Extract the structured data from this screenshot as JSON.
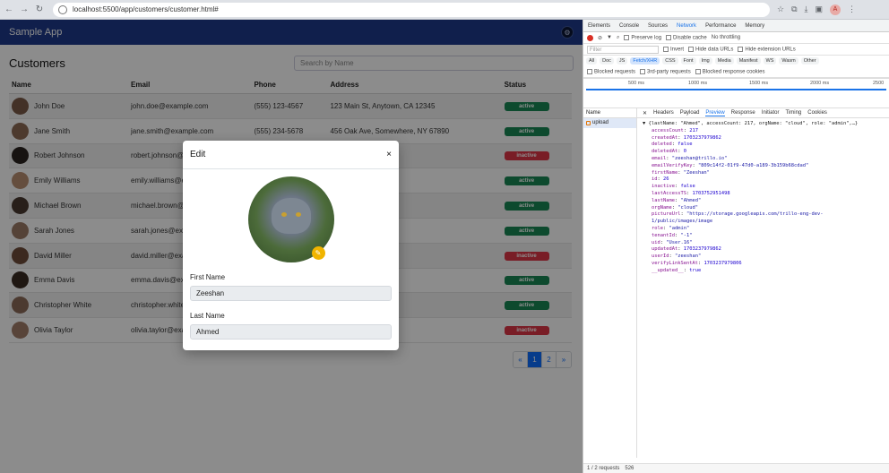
{
  "browser": {
    "url": "localhost:5500/app/customers/customer.html#",
    "profile_initial": "A"
  },
  "app": {
    "brand": "Sample App",
    "page_title": "Customers",
    "search_placeholder": "Search by Name",
    "columns": [
      "Name",
      "Email",
      "Phone",
      "Address",
      "Status"
    ],
    "rows": [
      {
        "name": "John Doe",
        "email": "john.doe@example.com",
        "phone": "(555) 123-4567",
        "address": "123 Main St, Anytown, CA 12345",
        "status": "active"
      },
      {
        "name": "Jane Smith",
        "email": "jane.smith@example.com",
        "phone": "(555) 234-5678",
        "address": "456 Oak Ave, Somewhere, NY 67890",
        "status": "active"
      },
      {
        "name": "Robert Johnson",
        "email": "robert.johnson@e",
        "phone": "",
        "address": "where, TX 45678",
        "status": "inactive"
      },
      {
        "name": "Emily Williams",
        "email": "emily.williams@ex",
        "phone": "",
        "address": "ytown, FL 98765",
        "status": "active"
      },
      {
        "name": "Michael Brown",
        "email": "michael.brown@e",
        "phone": "",
        "address": "where, CA 54321",
        "status": "active"
      },
      {
        "name": "Sarah Jones",
        "email": "sarah.jones@exa",
        "phone": "",
        "address": "ytown, TX 98765",
        "status": "active"
      },
      {
        "name": "David Miller",
        "email": "david.miller@exa",
        "phone": "",
        "address": "newhere, NY 23456",
        "status": "inactive"
      },
      {
        "name": "Emma Davis",
        "email": "emma.davis@exa",
        "phone": "",
        "address": "ewhere, CA 87654",
        "status": "active"
      },
      {
        "name": "Christopher White",
        "email": "christopher.white@",
        "phone": "",
        "address": "ytown, TX 76543",
        "status": "active"
      },
      {
        "name": "Olivia Taylor",
        "email": "olivia.taylor@exa",
        "phone": "",
        "address": "newhere, FL 65432",
        "status": "inactive"
      }
    ],
    "pagination": {
      "prev": "«",
      "pages": [
        "1",
        "2"
      ],
      "next": "»",
      "current": "1"
    }
  },
  "modal": {
    "title": "Edit",
    "close": "×",
    "first_name_label": "First Name",
    "first_name_value": "Zeeshan",
    "last_name_label": "Last Name",
    "last_name_value": "Ahmed"
  },
  "devtools": {
    "tabs": [
      "Elements",
      "Console",
      "Sources",
      "Network",
      "Performance",
      "Memory"
    ],
    "active_tab": "Network",
    "preserve_log": "Preserve log",
    "disable_cache": "Disable cache",
    "throttling": "No throttling",
    "filter_placeholder": "Filter",
    "invert": "Invert",
    "hide_data_urls": "Hide data URLs",
    "hide_ext_urls": "Hide extension URLs",
    "types": [
      "All",
      "Doc",
      "JS",
      "Fetch/XHR",
      "CSS",
      "Font",
      "Img",
      "Media",
      "Manifest",
      "WS",
      "Wasm",
      "Other"
    ],
    "active_type": "Fetch/XHR",
    "blocked_cookies": "Blocked response cookies",
    "blocked_requests": "Blocked requests",
    "third_party": "3rd-party requests",
    "timeline_ticks": [
      "500 ms",
      "1000 ms",
      "1500 ms",
      "2000 ms",
      "2500"
    ],
    "list_header": "Name",
    "request_name": "upload",
    "panel_tabs": [
      "Headers",
      "Payload",
      "Preview",
      "Response",
      "Initiator",
      "Timing",
      "Cookies"
    ],
    "active_panel_tab": "Preview",
    "summary": "{lastName: \"Ahmed\", accessCount: 217, orgName: \"cloud\", role: \"admin\",…}",
    "fields": [
      {
        "k": "accessCount",
        "v": "217",
        "t": "n"
      },
      {
        "k": "createdAt",
        "v": "1703237979862",
        "t": "n"
      },
      {
        "k": "deleted",
        "v": "false",
        "t": "n"
      },
      {
        "k": "deletedAt",
        "v": "0",
        "t": "n"
      },
      {
        "k": "email",
        "v": "\"zeeshan@trillo.io\"",
        "t": "s"
      },
      {
        "k": "emailVerifyKey",
        "v": "\"809c14f2-01f9-47d0-a189-3b159b68cdad\"",
        "t": "s"
      },
      {
        "k": "firstName",
        "v": "\"Zeeshan\"",
        "t": "s"
      },
      {
        "k": "id",
        "v": "26",
        "t": "n"
      },
      {
        "k": "inactive",
        "v": "false",
        "t": "n"
      },
      {
        "k": "lastAccessTS",
        "v": "1703752951498",
        "t": "n"
      },
      {
        "k": "lastName",
        "v": "\"Ahmed\"",
        "t": "s"
      },
      {
        "k": "orgName",
        "v": "\"cloud\"",
        "t": "s"
      },
      {
        "k": "pictureUrl",
        "v": "\"https://storage.googleapis.com/trillo-eng-dev-1/public/images/image",
        "t": "s"
      },
      {
        "k": "role",
        "v": "\"admin\"",
        "t": "s"
      },
      {
        "k": "tenantId",
        "v": "\"-1\"",
        "t": "s"
      },
      {
        "k": "uid",
        "v": "\"User.16\"",
        "t": "s"
      },
      {
        "k": "updatedAt",
        "v": "1703237979862",
        "t": "n"
      },
      {
        "k": "userId",
        "v": "\"zeeshan\"",
        "t": "s"
      },
      {
        "k": "verifyLinkSentAt",
        "v": "1703237979806",
        "t": "n"
      },
      {
        "k": "__updated__",
        "v": "true",
        "t": "n"
      }
    ],
    "status_requests": "1 / 2 requests",
    "status_size": "526"
  }
}
